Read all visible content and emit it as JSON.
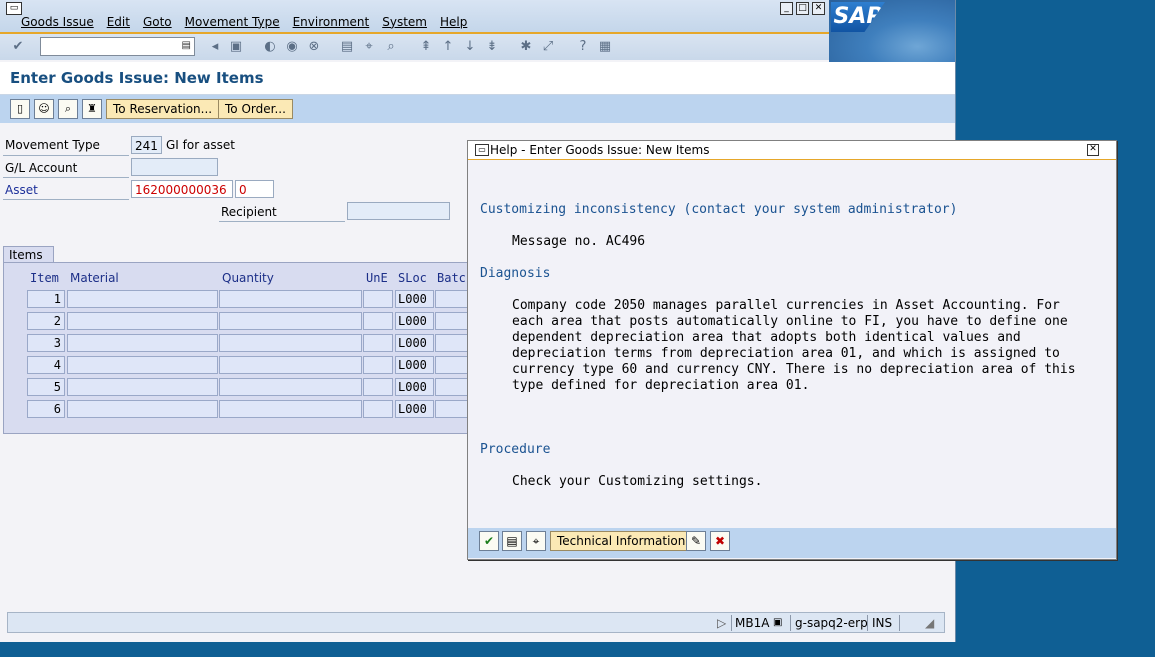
{
  "menubar": {
    "items": [
      "Goods Issue",
      "Edit",
      "Goto",
      "Movement Type",
      "Environment",
      "System",
      "Help"
    ]
  },
  "logo": {
    "text": "SAP"
  },
  "page": {
    "title": "Enter Goods Issue: New Items"
  },
  "apptoolbar": {
    "to_reservation": "To Reservation...",
    "to_order": "To Order..."
  },
  "header": {
    "movement_type_label": "Movement Type",
    "movement_type_value": "241",
    "movement_type_desc": "GI for asset",
    "gl_account_label": "G/L Account",
    "gl_account_value": "",
    "asset_label": "Asset",
    "asset_value": "162000000036",
    "asset_sub_value": "0",
    "recipient_label": "Recipient",
    "recipient_value": ""
  },
  "items": {
    "tab_label": "Items",
    "columns": [
      "Item",
      "Material",
      "Quantity",
      "UnE",
      "SLoc",
      "Batch"
    ],
    "rows": [
      {
        "item": "1",
        "sloc": "L000"
      },
      {
        "item": "2",
        "sloc": "L000"
      },
      {
        "item": "3",
        "sloc": "L000"
      },
      {
        "item": "4",
        "sloc": "L000"
      },
      {
        "item": "5",
        "sloc": "L000"
      },
      {
        "item": "6",
        "sloc": "L000"
      }
    ]
  },
  "statusbar": {
    "transaction": "MB1A",
    "server": "g-sapq2-erp",
    "mode": "INS"
  },
  "dialog": {
    "title": "Help - Enter Goods Issue: New Items",
    "heading": "Customizing inconsistency (contact your system administrator)",
    "message_no": "Message no. AC496",
    "diagnosis_label": "Diagnosis",
    "diagnosis_lines": [
      "Company code 2050 manages parallel currencies in Asset Accounting. For",
      "each area that posts automatically online to FI, you have to define one",
      "dependent depreciation area that adopts both identical values and",
      "depreciation terms from depreciation area 01, and which is assigned to",
      "currency type 60 and currency CNY. There is no depreciation area of this",
      "type defined for depreciation area 01."
    ],
    "procedure_label": "Procedure",
    "procedure_text": "Check your Customizing settings.",
    "tech_info_button": "Technical Information"
  },
  "colors": {
    "accent": "#e6a72a",
    "title_blue": "#184f80",
    "toolbar_bg": "#bcd4ef",
    "desktop": "#0f5f94",
    "error_red": "#cc0000"
  },
  "icons": [
    "check-icon",
    "save-icon",
    "back-icon",
    "exit-icon",
    "cancel-icon",
    "print-icon",
    "find-icon",
    "help-icon",
    "layout-icon",
    "pencil-icon",
    "close-icon"
  ]
}
